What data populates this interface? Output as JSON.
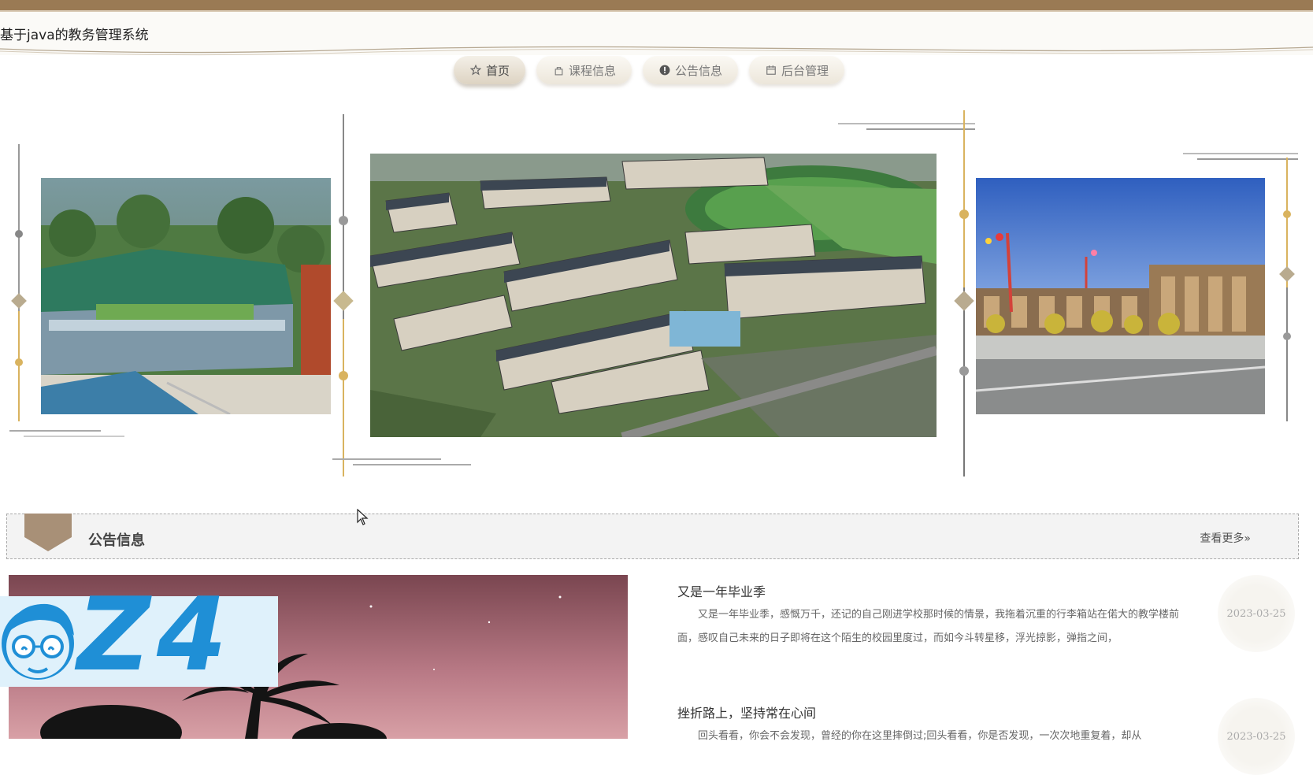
{
  "site": {
    "title": "基于java的教务管理系统"
  },
  "nav": {
    "items": [
      {
        "label": "首页",
        "icon": "star-icon",
        "active": true
      },
      {
        "label": "课程信息",
        "icon": "bag-icon",
        "active": false
      },
      {
        "label": "公告信息",
        "icon": "info-icon",
        "active": false
      },
      {
        "label": "后台管理",
        "icon": "calendar-icon",
        "active": false
      }
    ]
  },
  "carousel": {
    "total_slides": 3,
    "active_index": 0
  },
  "notice_section": {
    "title": "公告信息",
    "more_label": "查看更多»",
    "items": [
      {
        "title": "又是一年毕业季",
        "summary": "又是一年毕业季，感慨万千，还记的自己刚进学校那时候的情景，我拖着沉重的行李箱站在偌大的教学楼前面，感叹自己未来的日子即将在这个陌生的校园里度过，而如今斗转星移，浮光掠影，弹指之间，",
        "date": "2023-03-25"
      },
      {
        "title": "挫折路上，坚持常在心间",
        "summary": "回头看看，你会不会发现，曾经的你在这里摔倒过;回头看看，你是否发现，一次次地重复着，却从",
        "date": "2023-03-25"
      }
    ]
  },
  "watermark": {
    "text": "Z4"
  },
  "colors": {
    "accent": "#9a7a54",
    "gold": "#d9b35f",
    "badge": "#a89077"
  }
}
